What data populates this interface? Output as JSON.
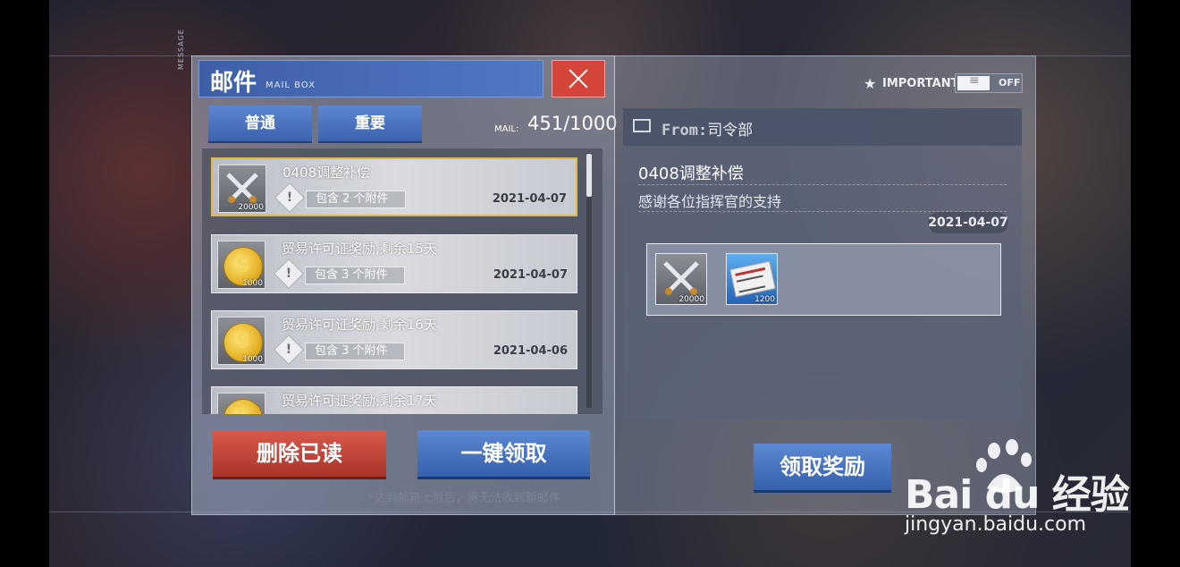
{
  "left_panel": {
    "side_tag": "MESSAGE",
    "title_cn": "邮件",
    "title_en": "MAIL BOX",
    "tabs": [
      {
        "label": "普通"
      },
      {
        "label": "重要"
      }
    ],
    "mail_label": "MAIL:",
    "mail_count": "451/1000",
    "mails": [
      {
        "title": "0408调整补偿",
        "icon": "crossed-swords-icon",
        "icon_num": "20000",
        "attach": "包含 2 个附件",
        "date": "2021-04-07",
        "selected": true
      },
      {
        "title": "贸易许可证奖励,剩余15天",
        "icon": "gold-coin-icon",
        "icon_num": "1000",
        "attach": "包含 3 个附件",
        "date": "2021-04-07"
      },
      {
        "title": "贸易许可证奖励,剩余16天",
        "icon": "gold-coin-icon",
        "icon_num": "1000",
        "attach": "包含 3 个附件",
        "date": "2021-04-06"
      },
      {
        "title": "贸易许可证奖励,剩余17天",
        "icon": "gold-coin-icon",
        "icon_num": "1000"
      }
    ],
    "delete_read_label": "删除已读",
    "claim_all_label": "一键领取",
    "notice": "*达到邮箱上限后，将无法收到新邮件"
  },
  "right_panel": {
    "important_label": "IMPORTANT",
    "toggle_state": "OFF",
    "from_prefix": "From:",
    "from_sender": "司令部",
    "detail_title": "0408调整补偿",
    "detail_body": "感谢各位指挥官的支持",
    "detail_date": "2021-04-07",
    "rewards": [
      {
        "icon": "crossed-swords-icon",
        "num": "20000"
      },
      {
        "icon": "document-icon",
        "num": "1200"
      }
    ],
    "claim_label": "领取奖励"
  },
  "watermark": {
    "brand": "Bai du 经验",
    "url": "jingyan.baidu.com"
  },
  "colors": {
    "accent_blue": "#3c63ad",
    "danger_red": "#d6453b",
    "selected_gold": "#e2b842"
  }
}
